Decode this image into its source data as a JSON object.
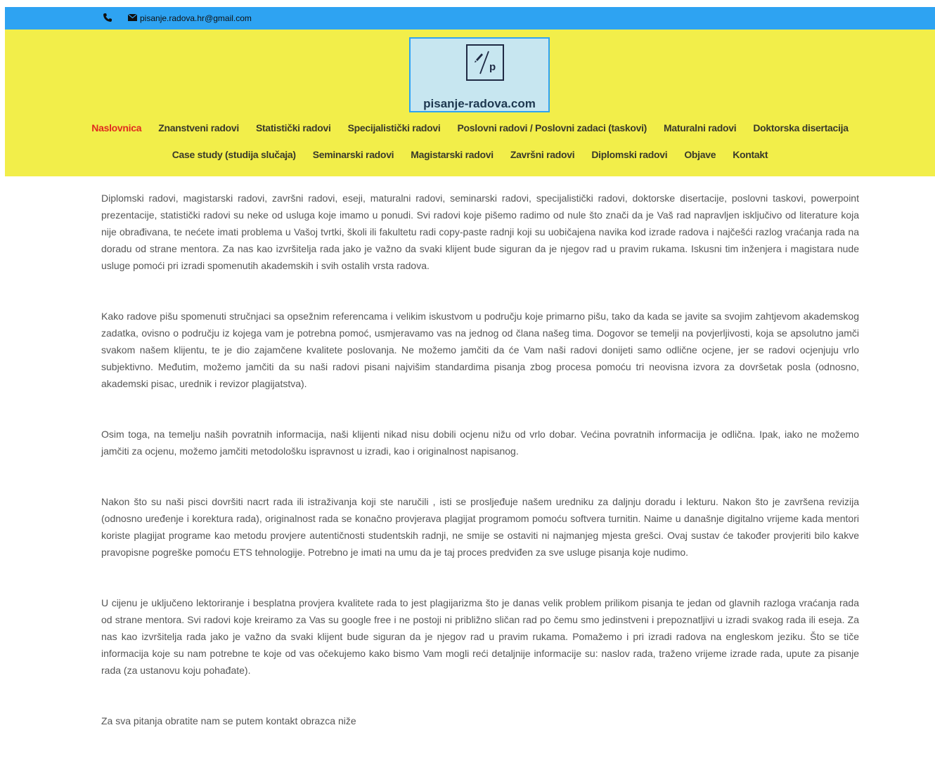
{
  "topbar": {
    "phone_icon": "phone-icon",
    "mail_icon": "envelope-icon",
    "email": "pisanje.radova.hr@gmail.com",
    "bg_color": "#2ea3f2"
  },
  "header": {
    "bg_color": "#f2ee4a",
    "logo": {
      "brand": "pisanje-radova.com",
      "mark_letter": "p",
      "icon": "pen-icon"
    },
    "nav_row1": [
      {
        "label": "Naslovnica",
        "active": true
      },
      {
        "label": "Znanstveni radovi"
      },
      {
        "label": "Statistički radovi"
      },
      {
        "label": "Specijalistički radovi"
      },
      {
        "label": "Poslovni radovi / Poslovni zadaci (taskovi)"
      },
      {
        "label": "Maturalni radovi"
      },
      {
        "label": "Doktorska disertacija"
      }
    ],
    "nav_row2": [
      {
        "label": "Case study (studija slučaja)"
      },
      {
        "label": "Seminarski radovi"
      },
      {
        "label": "Magistarski radovi"
      },
      {
        "label": "Završni radovi"
      },
      {
        "label": "Diplomski radovi"
      },
      {
        "label": "Objave"
      },
      {
        "label": "Kontakt"
      }
    ],
    "active_color": "#e02b20"
  },
  "content": {
    "paragraphs": [
      "Diplomski radovi, magistarski radovi, završni radovi, eseji, maturalni radovi, seminarski radovi, specijalistički radovi, doktorske disertacije, poslovni taskovi, powerpoint prezentacije, statistički radovi su neke od usluga koje imamo u ponudi. Svi radovi koje pišemo radimo od nule što znači da je Vaš rad napravljen isključivo od literature koja nije obrađivana, te nećete imati problema u Vašoj tvrtki, školi ili fakultetu radi copy-paste radnji koji su uobičajena navika kod izrade radova i najčešći razlog vraćanja rada na doradu od strane mentora. Za nas kao izvršitelja rada jako je važno da svaki klijent bude siguran da je njegov rad u pravim rukama. Iskusni tim inženjera i magistara nude usluge pomoći pri izradi spomenutih akademskih i svih ostalih vrsta radova.",
      "Kako radove pišu spomenuti stručnjaci sa opsežnim referencama i velikim iskustvom u području koje primarno pišu, tako da kada se javite sa svojim zahtjevom akademskog zadatka, ovisno o području iz kojega vam je potrebna pomoć, usmjeravamo vas na jednog od člana našeg tima. Dogovor se temelji na povjerljivosti, koja se apsolutno jamči svakom našem klijentu, te je dio zajamčene kvalitete poslovanja. Ne možemo jamčiti da će Vam naši radovi donijeti samo odlične ocjene, jer se radovi ocjenjuju vrlo subjektivno. Međutim, možemo jamčiti da su naši radovi pisani najvišim standardima pisanja zbog procesa pomoću tri neovisna izvora za dovršetak posla (odnosno, akademski pisac, urednik i revizor plagijatstva).",
      "Osim toga, na temelju naših povratnih informacija, naši klijenti nikad nisu dobili ocjenu nižu od vrlo dobar. Većina povratnih informacija je odlična. Ipak, iako ne možemo jamčiti za ocjenu, možemo jamčiti metodološku ispravnost u izradi, kao i originalnost napisanog.",
      "Nakon što su naši pisci dovršiti nacrt rada ili istraživanja koji ste naručili , isti se prosljeđuje našem uredniku za daljnju doradu i lekturu. Nakon što je završena revizija (odnosno uređenje i korektura rada), originalnost rada se konačno provjerava plagijat programom pomoću softvera turnitin. Naime u današnje digitalno vrijeme kada mentori koriste plagijat programe kao metodu provjere autentičnosti studentskih radnji, ne smije se ostaviti ni najmanjeg mjesta grešci. Ovaj sustav će također provjeriti bilo kakve pravopisne pogreške pomoću ETS tehnologije. Potrebno je imati na umu da je taj proces predviđen za sve usluge pisanja koje nudimo.",
      "U cijenu je uključeno lektoriranje i besplatna provjera kvalitete rada to jest plagijarizma što je danas velik problem prilikom pisanja te jedan od glavnih razloga vraćanja rada od strane mentora. Svi radovi koje kreiramo za Vas su google free i ne postoji ni približno sličan rad po čemu smo jedinstveni i prepoznatljivi u izradi svakog rada ili eseja. Za nas kao izvršitelja rada jako je važno da svaki klijent bude siguran da je njegov rad u pravim rukama. Pomažemo i pri izradi radova na engleskom jeziku. Što se tiče informacija koje su nam potrebne te koje od vas očekujemo kako bismo Vam mogli reći detaljnije informacije su: naslov rada, traženo vrijeme izrade rada, upute za pisanje rada (za ustanovu koju pohađate).",
      "Za sva pitanja obratite nam se putem kontakt obrazca niže"
    ]
  }
}
